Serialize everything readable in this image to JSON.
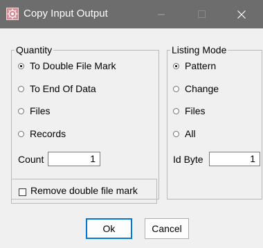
{
  "window": {
    "title": "Copy Input Output",
    "icon": "app-icon",
    "controls": [
      "minimize-icon",
      "maximize-icon",
      "close-icon"
    ],
    "titlebar_color": "#6d6d6d"
  },
  "quantity": {
    "legend": "Quantity",
    "options": [
      {
        "label": "To Double File Mark",
        "checked": true
      },
      {
        "label": "To End Of Data",
        "checked": false
      },
      {
        "label": "Files",
        "checked": false
      },
      {
        "label": "Records",
        "checked": false
      }
    ],
    "count_label": "Count",
    "count_value": "1"
  },
  "listing_mode": {
    "legend": "Listing Mode",
    "options": [
      {
        "label": "Pattern",
        "checked": true
      },
      {
        "label": "Change",
        "checked": false
      },
      {
        "label": "Files",
        "checked": false
      },
      {
        "label": "All",
        "checked": false
      }
    ],
    "id_byte_label": "Id Byte",
    "id_byte_value": "1"
  },
  "remove_double_file_mark": {
    "label": "Remove double file mark",
    "checked": false
  },
  "buttons": {
    "ok": "Ok",
    "cancel": "Cancel"
  }
}
